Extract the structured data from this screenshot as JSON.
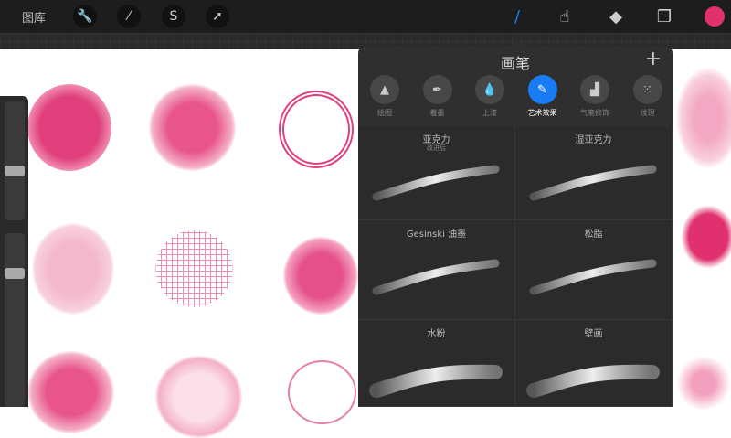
{
  "topbar": {
    "gallery": "图库",
    "tools": [
      "wrench-icon",
      "magic-wand-icon",
      "selection-icon",
      "transform-arrow-icon"
    ],
    "right_tools": [
      "brush-icon",
      "smudge-icon",
      "eraser-icon",
      "layers-icon"
    ],
    "current_color": "#e0306e",
    "active_tool_color": "#1a7cf5"
  },
  "panel": {
    "title": "画笔",
    "add": "+",
    "categories": [
      {
        "label": "绘图",
        "icon": "▲"
      },
      {
        "label": "着墨",
        "icon": "✒"
      },
      {
        "label": "上漆",
        "icon": "💧"
      },
      {
        "label": "艺术效果",
        "icon": "✎"
      },
      {
        "label": "气笔修饰",
        "icon": "▟"
      },
      {
        "label": "纹理",
        "icon": "⁙"
      }
    ],
    "active_category": 3,
    "brushes": [
      {
        "name": "亚克力",
        "sub": "改进后"
      },
      {
        "name": "湿亚克力"
      },
      {
        "name": "Gesinski 油墨"
      },
      {
        "name": "松脂"
      },
      {
        "name": "水粉"
      },
      {
        "name": "壁画"
      }
    ]
  }
}
